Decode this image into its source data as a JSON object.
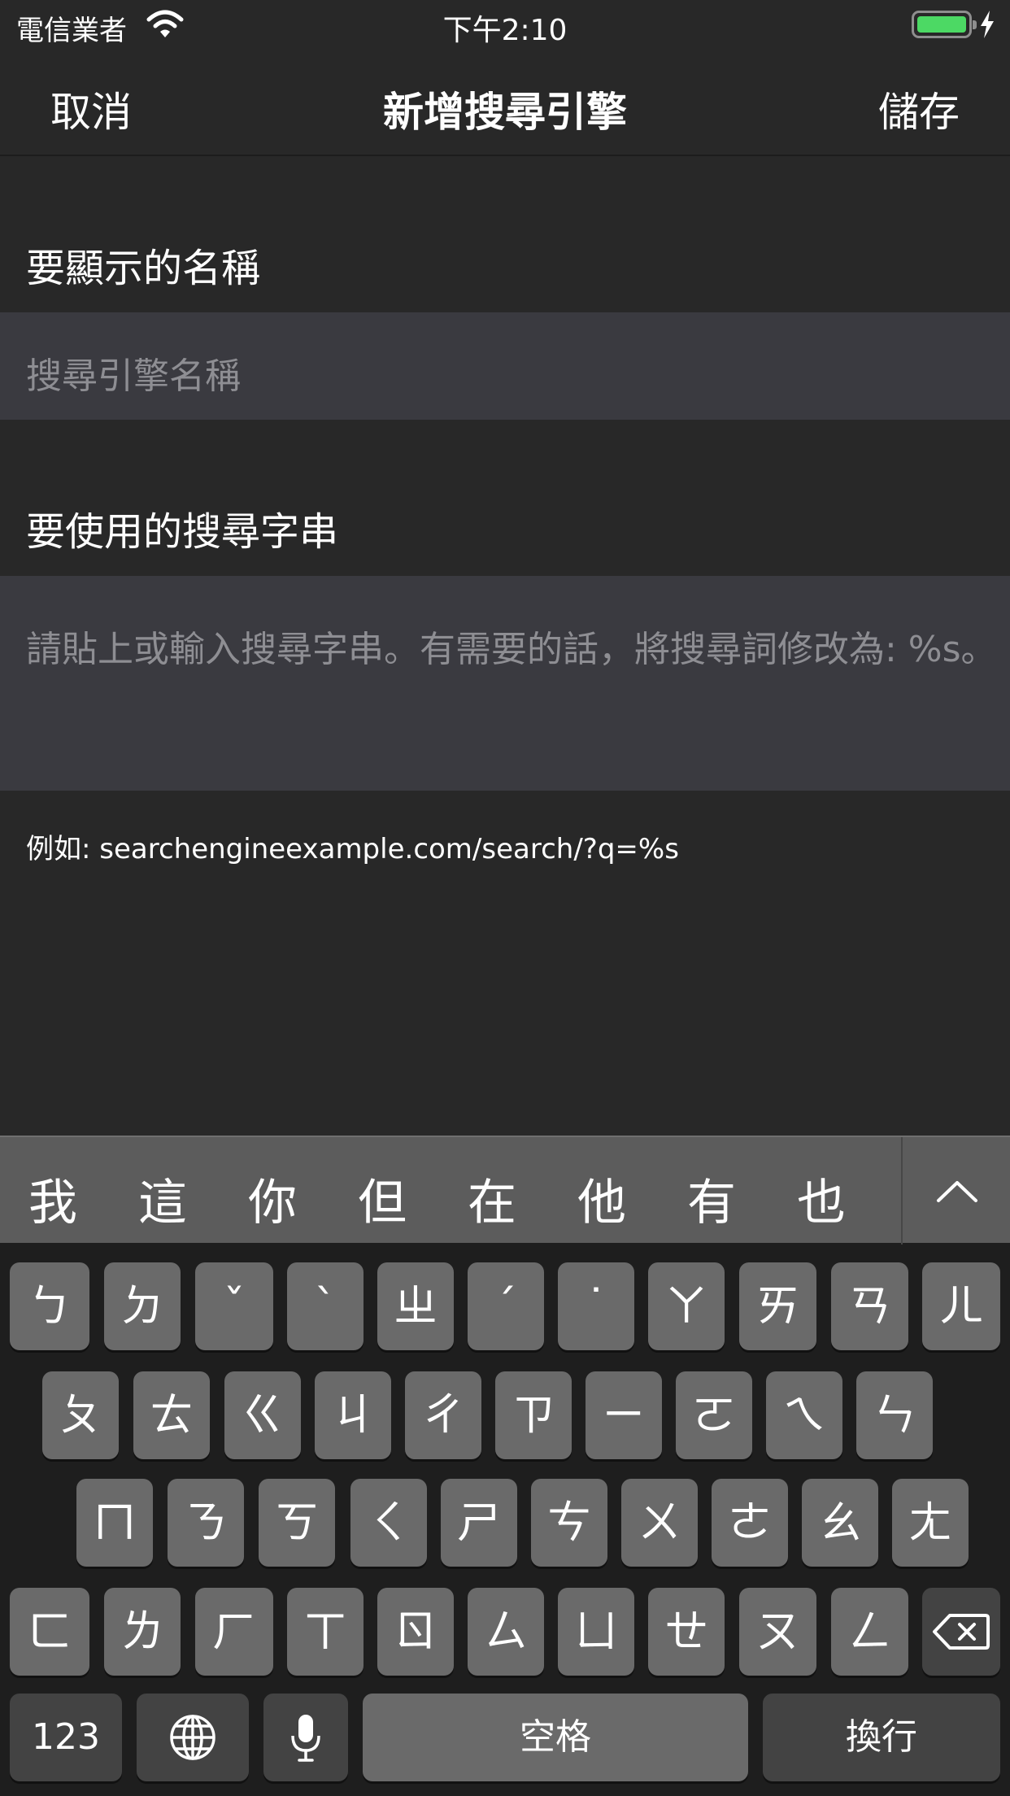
{
  "status": {
    "carrier": "電信業者",
    "time": "下午2:10"
  },
  "nav": {
    "cancel": "取消",
    "title": "新增搜尋引擎",
    "save": "儲存"
  },
  "name_section": {
    "header": "要顯示的名稱",
    "placeholder": "搜尋引擎名稱"
  },
  "url_section": {
    "header": "要使用的搜尋字串",
    "placeholder": "請貼上或輸入搜尋字串。有需要的話，將搜尋詞修改為: %s。",
    "example": "例如: searchengineexample.com/search/?q=%s"
  },
  "keyboard": {
    "candidates": [
      "我",
      "這",
      "你",
      "但",
      "在",
      "他",
      "有",
      "也"
    ],
    "row1": [
      "ㄅ",
      "ㄉ",
      "ˇ",
      "ˋ",
      "ㄓ",
      "ˊ",
      "˙",
      "ㄚ",
      "ㄞ",
      "ㄢ",
      "ㄦ"
    ],
    "row2": [
      "ㄆ",
      "ㄊ",
      "ㄍ",
      "ㄐ",
      "ㄔ",
      "ㄗ",
      "ㄧ",
      "ㄛ",
      "ㄟ",
      "ㄣ"
    ],
    "row3": [
      "ㄇ",
      "ㄋ",
      "ㄎ",
      "ㄑ",
      "ㄕ",
      "ㄘ",
      "ㄨ",
      "ㄜ",
      "ㄠ",
      "ㄤ"
    ],
    "row4": [
      "ㄈ",
      "ㄌ",
      "ㄏ",
      "ㄒ",
      "ㄖ",
      "ㄙ",
      "ㄩ",
      "ㄝ",
      "ㄡ",
      "ㄥ"
    ],
    "numbers_label": "123",
    "space_label": "空格",
    "return_label": "換行",
    "icons": {
      "globe": "globe-icon",
      "mic": "microphone-icon",
      "delete": "delete-icon",
      "expand": "chevron-up-icon"
    }
  }
}
